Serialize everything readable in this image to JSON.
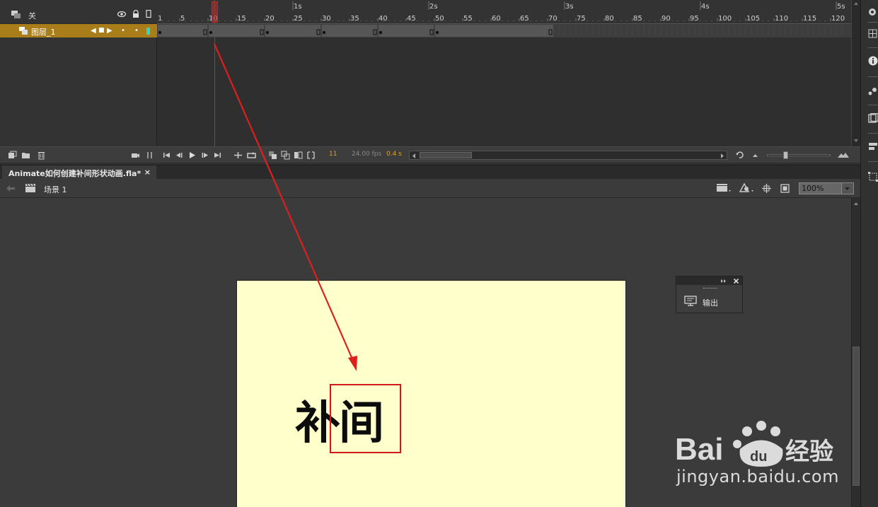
{
  "timeline": {
    "header_label": "关",
    "layer": {
      "name": "图层_1",
      "color": "#2fd7c2",
      "row_color": "#a87d1a"
    },
    "frame_numbers": [
      "1",
      "5",
      "10",
      "15",
      "20",
      "25",
      "30",
      "35",
      "40",
      "45",
      "50",
      "55",
      "60",
      "65",
      "70",
      "75",
      "80",
      "85",
      "90",
      "95",
      "100",
      "105",
      "110",
      "115",
      "120"
    ],
    "second_marks": [
      "1s",
      "2s",
      "3s",
      "4s",
      "5s"
    ],
    "current_frame_playhead": 10,
    "keyframes": [
      1,
      10,
      20,
      30,
      40,
      50
    ],
    "tween_end_frames": [
      9,
      19,
      29,
      39,
      49,
      70
    ],
    "last_frame": 70,
    "status": {
      "current_frame": "11",
      "fps": "24.00 fps",
      "elapsed": "0.4 s"
    }
  },
  "document": {
    "tab_title": "Animate如何创建补间形状动画.fla*",
    "tab_close": "×",
    "scene_label": "场景 1",
    "zoom": "100%"
  },
  "stage": {
    "text": "补间",
    "background": "#ffffcc"
  },
  "output_panel": {
    "label": "输出"
  },
  "watermark": {
    "url": "jingyan.baidu.com"
  },
  "colors": {
    "accent_red": "#d62020",
    "panel_bg": "#3b3b3b",
    "timeline_bg": "#2f2f2f"
  }
}
